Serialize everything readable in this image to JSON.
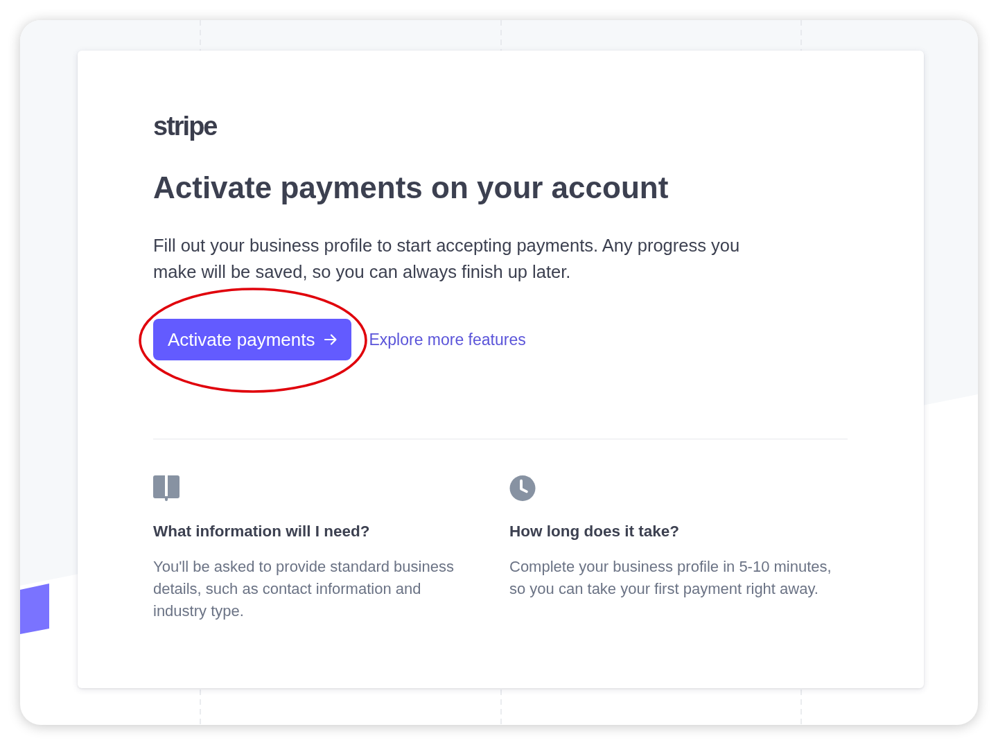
{
  "logo": "stripe",
  "title": "Activate payments on your account",
  "description": "Fill out your business profile to start accepting payments. Any progress you make will be saved, so you can always finish up later.",
  "primary_button": {
    "label": "Activate payments",
    "circled": true
  },
  "link": "Explore more features",
  "info_sections": [
    {
      "kind": "book",
      "heading": "What information will I need?",
      "text": "You'll be asked to provide standard business details, such as contact information and industry type."
    },
    {
      "kind": "clock",
      "heading": "How long does it take?",
      "text": "Complete your business profile in 5-10 minutes, so you can take your first payment right away."
    }
  ]
}
